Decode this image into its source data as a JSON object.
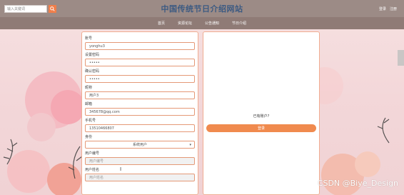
{
  "header": {
    "search_placeholder": "输入关键词",
    "site_title": "中国传统节日介绍网站",
    "links": [
      "登录",
      "注册"
    ]
  },
  "nav": [
    "首页",
    "资源论坛",
    "公告通知",
    "节日介绍"
  ],
  "form": {
    "fields": [
      {
        "label": "账号",
        "value": "yonghu3",
        "gray": false
      },
      {
        "label": "设置密码",
        "value": "•••••",
        "gray": false
      },
      {
        "label": "确认密码",
        "value": "•••••",
        "gray": false
      },
      {
        "label": "昵称",
        "value": "用户3",
        "gray": false
      },
      {
        "label": "邮箱",
        "value": "345678@qq.com",
        "gray": false
      },
      {
        "label": "手机号",
        "value": "13510466807",
        "gray": false
      }
    ],
    "identity_label": "身份",
    "identity_value": "系统用户",
    "extra_fields": [
      {
        "label": "用户编号",
        "value": "用户编号"
      },
      {
        "label": "用户姓名",
        "value": "用户姓名"
      }
    ]
  },
  "login_panel": {
    "question": "已有账户?",
    "login_button": "登录"
  },
  "watermark": "CSDN @Biye_Design",
  "colors": {
    "topbar": "#9c8b86",
    "nav": "#8f7b76",
    "accent": "#f08a4e",
    "title": "#3c5a82"
  }
}
